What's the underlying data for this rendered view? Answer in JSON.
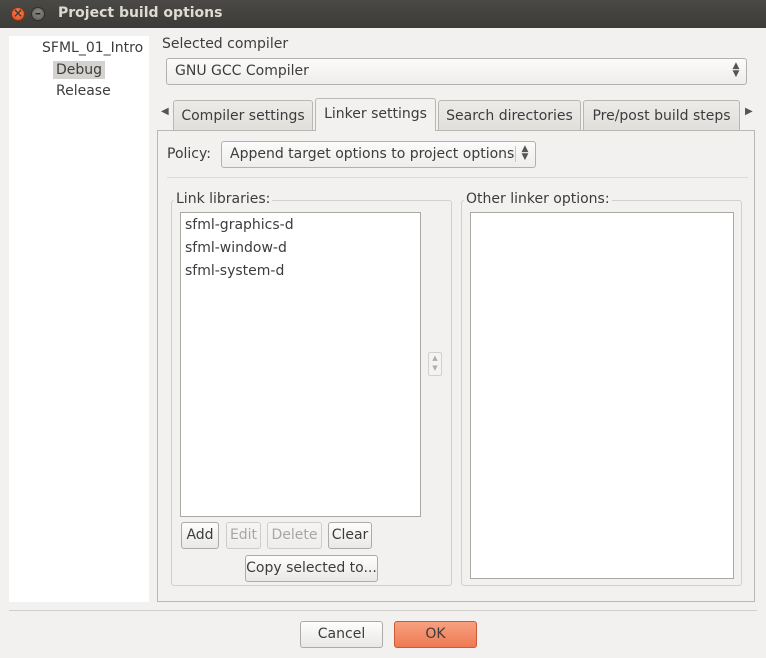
{
  "window": {
    "title": "Project build options"
  },
  "tree": {
    "items": [
      "SFML_01_Intro",
      "Debug",
      "Release"
    ],
    "selected": "Debug"
  },
  "compiler": {
    "label": "Selected compiler",
    "value": "GNU GCC Compiler"
  },
  "tabs": [
    "Compiler settings",
    "Linker settings",
    "Search directories",
    "Pre/post build steps"
  ],
  "active_tab": "Linker settings",
  "policy": {
    "label": "Policy:",
    "value": "Append target options to project options"
  },
  "link_libraries": {
    "label": "Link libraries:",
    "items": [
      "sfml-graphics-d",
      "sfml-window-d",
      "sfml-system-d"
    ]
  },
  "other_linker_options": {
    "label": "Other linker options:"
  },
  "buttons": {
    "add": "Add",
    "edit": "Edit",
    "delete": "Delete",
    "clear": "Clear",
    "copy": "Copy selected to...",
    "cancel": "Cancel",
    "ok": "OK"
  },
  "colors": {
    "accent": "#ee7a52",
    "titlebar": "#3c3b37",
    "selection": "#d4d2cf"
  },
  "icons": {
    "close": "close-icon",
    "minimize": "minimize-icon",
    "tab_left": "chevron-left-icon",
    "tab_right": "chevron-right-icon"
  }
}
